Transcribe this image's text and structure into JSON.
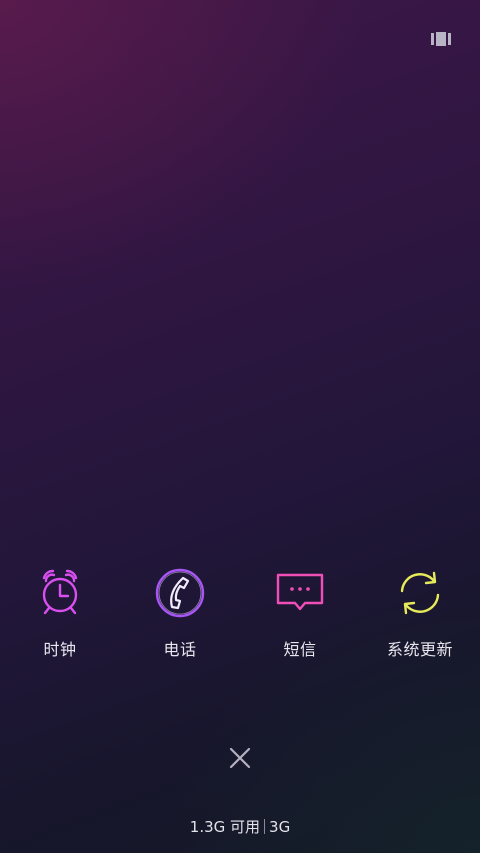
{
  "top_bar": {
    "recents_icon": "recents-grid-icon"
  },
  "apps": [
    {
      "label": "时钟",
      "icon": "alarm-clock-icon",
      "color": "#d94ff0"
    },
    {
      "label": "电话",
      "icon": "phone-icon",
      "color": "#a855f7"
    },
    {
      "label": "短信",
      "icon": "message-icon",
      "color": "#f04fb8"
    },
    {
      "label": "系统更新",
      "icon": "sync-icon",
      "color": "#e6ea5a"
    }
  ],
  "close_button": {
    "icon": "close-icon"
  },
  "memory_info": {
    "available": "1.3G 可用",
    "total": "3G"
  }
}
